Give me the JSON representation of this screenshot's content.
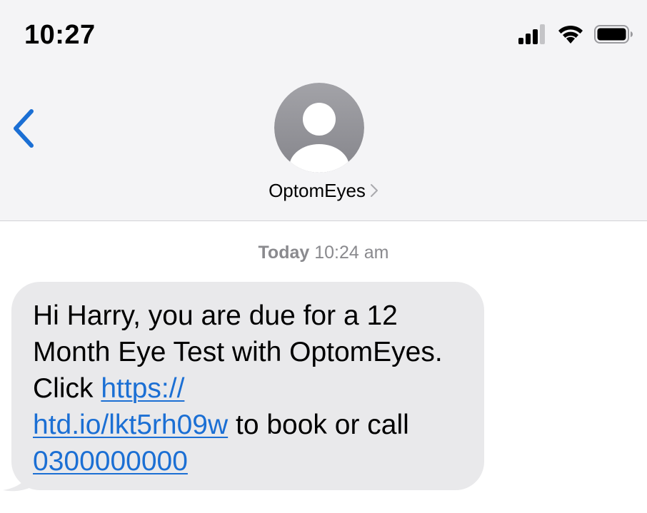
{
  "status_bar": {
    "time": "10:27",
    "icons": [
      "cellular-signal-icon",
      "wifi-icon",
      "battery-icon"
    ]
  },
  "nav": {
    "back_icon": "chevron-left-icon",
    "contact_name": "OptomEyes",
    "contact_chevron_icon": "chevron-right-icon",
    "avatar_icon": "person-silhouette-icon"
  },
  "thread": {
    "timestamp_day": "Today",
    "timestamp_time": "10:24 am",
    "message": {
      "text_before_link": "Hi Harry, you are due for a 12 Month Eye Test with OptomEyes. Click ",
      "url_line1": "https://",
      "url_line2": "htd.io/lkt5rh09w",
      "text_middle": " to book or call ",
      "phone": "0300000000"
    }
  },
  "colors": {
    "accent_blue": "#1b6fd4",
    "bubble_grey": "#e9e9eb",
    "header_grey": "#f4f4f6",
    "timestamp_grey": "#8a8a8e",
    "avatar_grey": "#8e8e93"
  }
}
